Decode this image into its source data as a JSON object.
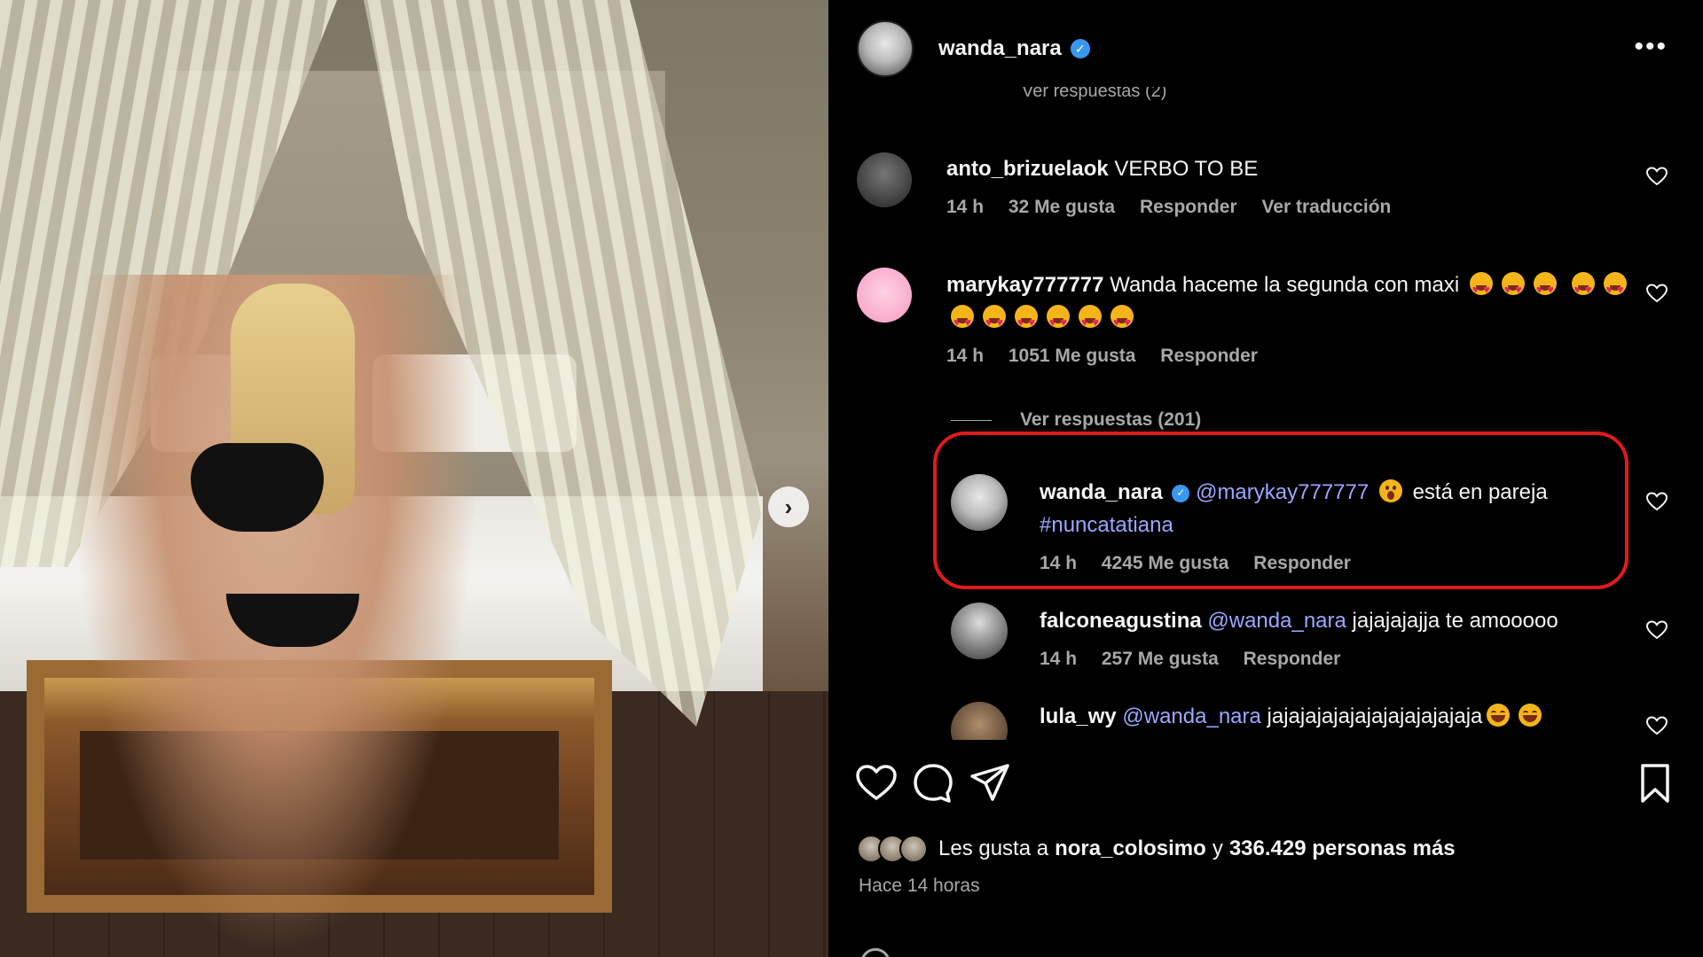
{
  "post": {
    "author": "wanda_nara",
    "more_icon": "more-horizontal-icon"
  },
  "partial_replies_label": "Ver respuestas (2)",
  "comments": [
    {
      "user": "anto_brizuelaok",
      "text": "VERBO TO BE",
      "time": "14 h",
      "likes": "32 Me gusta",
      "reply": "Responder",
      "translate": "Ver traducción"
    },
    {
      "user": "marykay777777",
      "text": "Wanda haceme la segunda con maxi",
      "time": "14 h",
      "likes": "1051 Me gusta",
      "reply": "Responder",
      "emoji": "smiling-face-with-heart-eyes",
      "emoji_count": 11
    }
  ],
  "view_replies": "Ver respuestas (201)",
  "replies": [
    {
      "user": "wanda_nara",
      "mention": "@marykay777777",
      "text": "está en pareja",
      "hashtag": "#nuncatatiana",
      "time": "14 h",
      "likes": "4245 Me gusta",
      "reply": "Responder",
      "emoji": "face-with-open-mouth",
      "highlight_color": "#e01a1a"
    },
    {
      "user": "falconeagustina",
      "mention": "@wanda_nara",
      "text": "jajajajajja te amooooo",
      "time": "14 h",
      "likes": "257 Me gusta",
      "reply": "Responder"
    },
    {
      "user": "lula_wy",
      "mention": "@wanda_nara",
      "text": "jajajajajajajajajajajajaja",
      "emoji": "grinning-squinting-face",
      "emoji_count": 2
    }
  ],
  "likes_summary": {
    "prefix": "Les gusta a",
    "user": "nora_colosimo",
    "middle": "y",
    "count": "336.429 personas más"
  },
  "posted": "Hace 14 horas",
  "colors": {
    "background": "#000000",
    "text": "#f5f5f5",
    "secondary": "#a8a8a8",
    "mention": "#9aa7ff",
    "verified": "#3897f0",
    "highlight": "#e01a1a"
  }
}
